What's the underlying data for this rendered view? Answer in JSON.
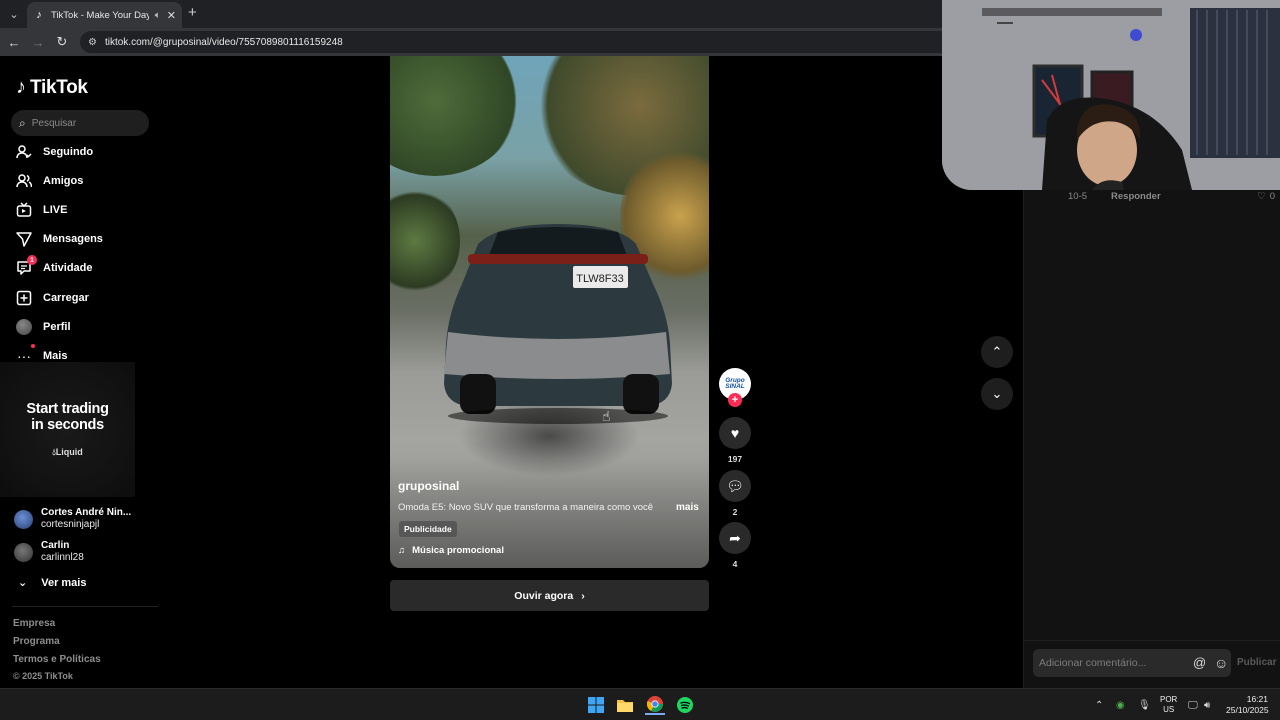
{
  "browser": {
    "tab_title": "TikTok - Make Your Day",
    "url": "tiktok.com/@gruposinal/video/7557089801116159248",
    "new_tab": "+",
    "tab_close": "✕"
  },
  "sidebar": {
    "logo_text": "TikTok",
    "search_placeholder": "Pesquisar",
    "nav": [
      {
        "label": "Seguindo",
        "icon": "following-icon"
      },
      {
        "label": "Amigos",
        "icon": "friends-icon"
      },
      {
        "label": "LIVE",
        "icon": "live-icon"
      },
      {
        "label": "Mensagens",
        "icon": "messages-icon"
      },
      {
        "label": "Atividade",
        "icon": "activity-icon",
        "badge": "1"
      },
      {
        "label": "Carregar",
        "icon": "upload-icon"
      },
      {
        "label": "Perfil",
        "icon": "avatar"
      },
      {
        "label": "Mais",
        "icon": "more-icon"
      }
    ],
    "ad": {
      "title_line1": "Start trading",
      "title_line2": "in seconds",
      "brand": "Liquid"
    },
    "following": [
      {
        "name": "Cortes André Nin...",
        "handle": "cortesninjapjl"
      },
      {
        "name": "Carlin",
        "handle": "carlinnl28"
      }
    ],
    "see_more": "Ver mais",
    "footer": [
      "Empresa",
      "Programa",
      "Termos e Políticas"
    ],
    "copyright": "© 2025 TikTok"
  },
  "video": {
    "author": "gruposinal",
    "description": "Omoda E5: Novo SUV que transforma a maneira como você",
    "more": "mais",
    "ad_tag": "Publicidade",
    "music": "Música promocional",
    "plate": "TLW8F33",
    "listen_button": "Ouvir agora"
  },
  "actions": {
    "brand_avatar_line1": "Grupo",
    "brand_avatar_line2": "SINAL",
    "likes": "197",
    "comments": "2",
    "shares": "4"
  },
  "comments_panel": {
    "date": "10-5",
    "reply": "Responder",
    "like_count": "0",
    "input_placeholder": "Adicionar comentário...",
    "publish": "Publicar"
  },
  "taskbar": {
    "lang_line1": "POR",
    "lang_line2": "US",
    "time": "16:21",
    "date": "25/10/2025"
  },
  "colors": {
    "accent": "#fe2c55",
    "background": "#000000",
    "panel": "#121212"
  }
}
